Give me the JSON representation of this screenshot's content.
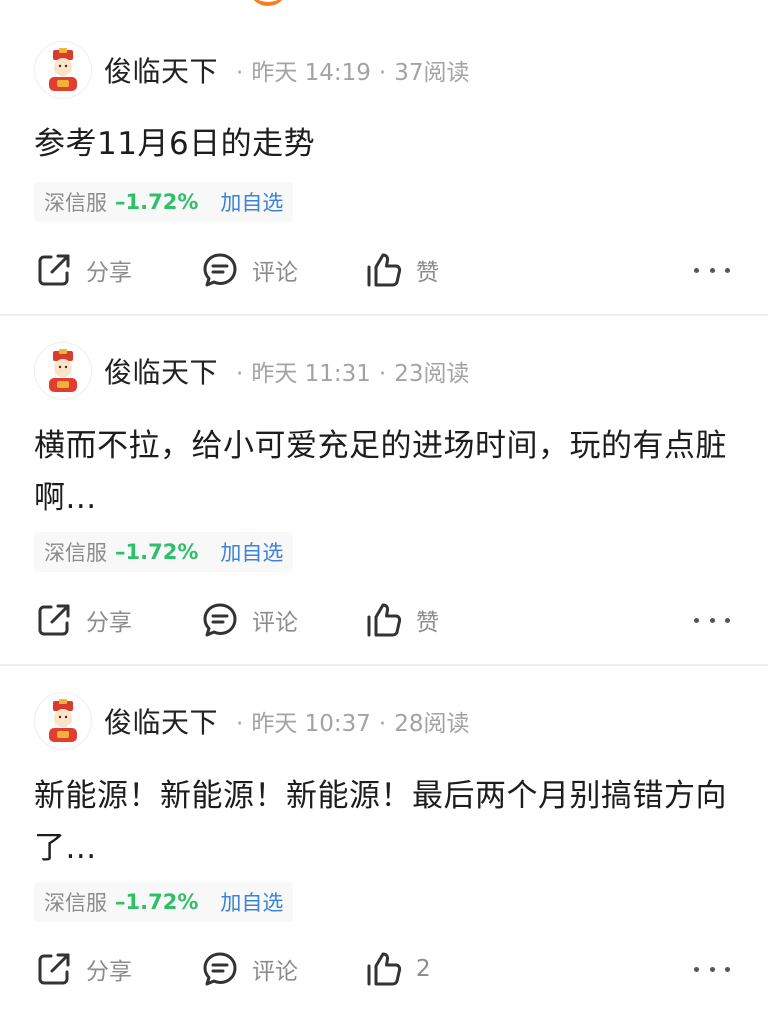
{
  "colors": {
    "stock_down": "#2fbf6a",
    "link": "#3b82d9",
    "muted": "#a3a3a3",
    "accent": "#ff7a1a"
  },
  "posts": [
    {
      "author": "俊临天下",
      "time": "昨天 14:19",
      "reads": "37阅读",
      "content": "参考11月6日的走势",
      "stock": {
        "name": "深信服",
        "change": "–1.72%",
        "add_label": "加自选"
      },
      "actions": {
        "share": "分享",
        "comment": "评论",
        "like": "赞"
      }
    },
    {
      "author": "俊临天下",
      "time": "昨天 11:31",
      "reads": "23阅读",
      "content": "横而不拉，给小可爱充足的进场时间，玩的有点脏啊...",
      "stock": {
        "name": "深信服",
        "change": "–1.72%",
        "add_label": "加自选"
      },
      "actions": {
        "share": "分享",
        "comment": "评论",
        "like": "赞"
      }
    },
    {
      "author": "俊临天下",
      "time": "昨天 10:37",
      "reads": "28阅读",
      "content": "新能源！新能源！新能源！最后两个月别搞错方向了...",
      "stock": {
        "name": "深信服",
        "change": "–1.72%",
        "add_label": "加自选"
      },
      "actions": {
        "share": "分享",
        "comment": "评论",
        "like": "2"
      }
    }
  ],
  "icons": [
    "share-icon",
    "comment-icon",
    "like-icon",
    "more-icon",
    "avatar-icon"
  ]
}
